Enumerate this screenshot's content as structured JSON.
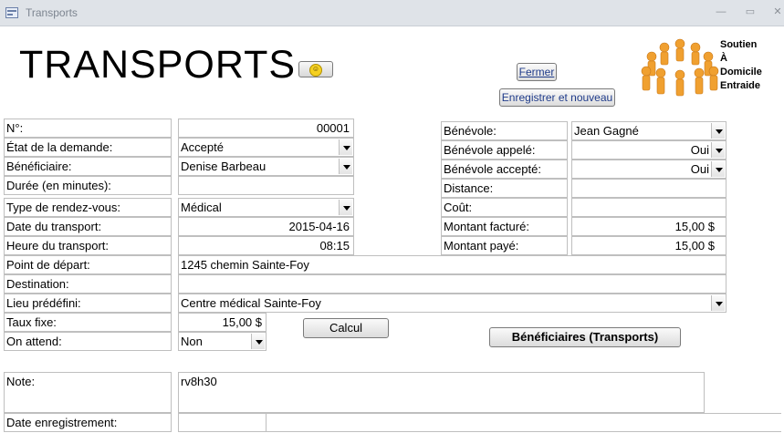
{
  "window": {
    "title": "Transports"
  },
  "header": {
    "title": "TRANSPORTS",
    "smiley_glyph": "☺",
    "fermer_label": "Fermer",
    "save_new_label": "Enregistrer et nouveau",
    "logo_text_line1": "Soutien",
    "logo_text_line2": "À",
    "logo_text_line3": "Domicile",
    "logo_text_line4": "Entraide",
    "logo_color": "#f0a030"
  },
  "left": {
    "no_label": "N°:",
    "no_value": "00001",
    "etat_label": "État de la demande:",
    "etat_value": "Accepté",
    "beneficiaire_label": "Bénéficiaire:",
    "beneficiaire_value": "Denise Barbeau",
    "duree_label": "Durée (en minutes):",
    "duree_value": "",
    "type_label": "Type de rendez-vous:",
    "type_value": "Médical",
    "date_label": "Date du transport:",
    "date_value": "2015-04-16",
    "heure_label": "Heure du transport:",
    "heure_value": "08:15",
    "depart_label": "Point de départ:",
    "depart_value": "1245 chemin Sainte-Foy",
    "destination_label": "Destination:",
    "destination_value": "",
    "lieu_label": "Lieu prédéfini:",
    "lieu_value": "Centre médical Sainte-Foy",
    "taux_label": "Taux fixe:",
    "taux_value": "15,00 $",
    "attend_label": "On attend:",
    "attend_value": "Non",
    "note_label": "Note:",
    "note_value": "rv8h30",
    "date_enr_label": "Date enregistrement:"
  },
  "right": {
    "benevole_label": "Bénévole:",
    "benevole_value": "Jean Gagné",
    "appele_label": "Bénévole appelé:",
    "appele_value": "Oui",
    "accepte_label": "Bénévole accepté:",
    "accepte_value": "Oui",
    "distance_label": "Distance:",
    "distance_value": "",
    "cout_label": "Coût:",
    "cout_value": "",
    "facture_label": "Montant facturé:",
    "facture_value": "15,00 $",
    "paye_label": "Montant  payé:",
    "paye_value": "15,00 $"
  },
  "buttons": {
    "calcul_label": "Calcul",
    "beneficiaires_label": "Bénéficiaires (Transports)"
  }
}
